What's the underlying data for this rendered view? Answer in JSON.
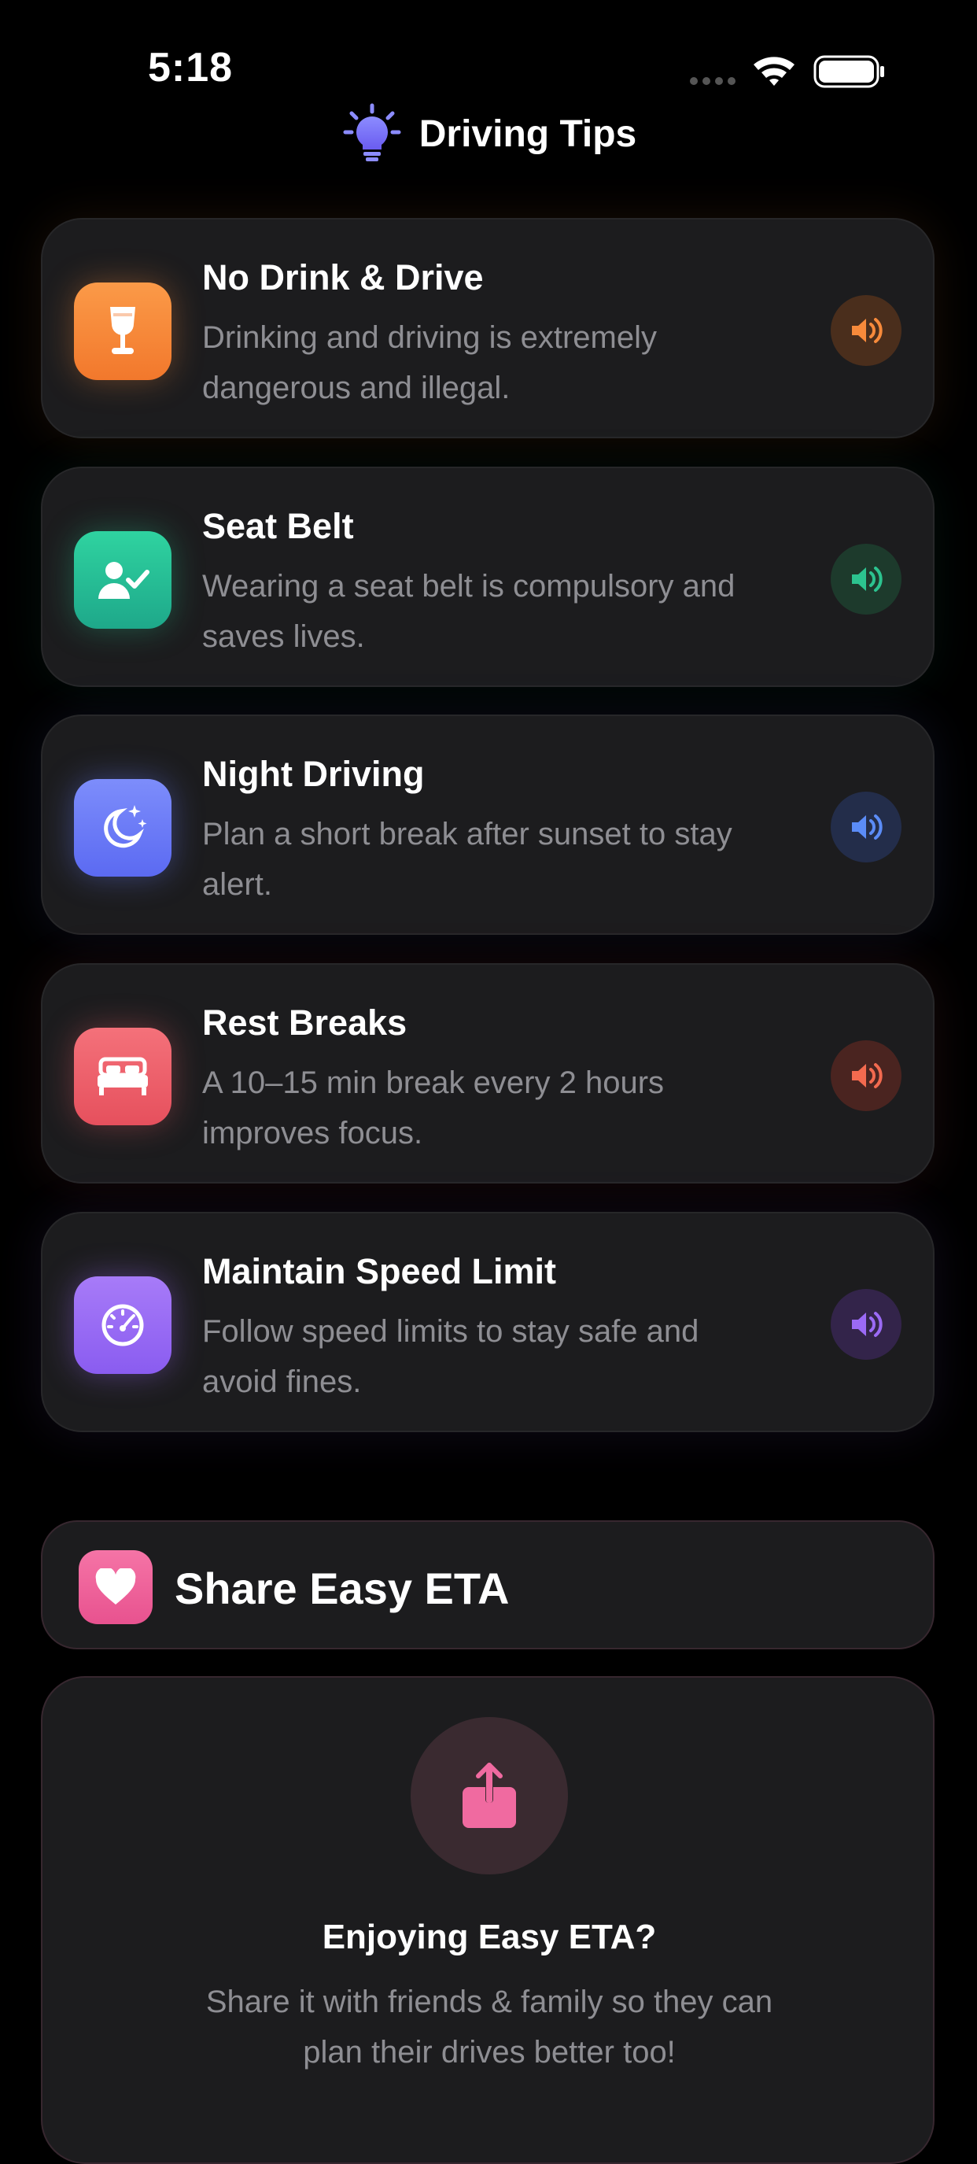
{
  "status_bar": {
    "time": "5:18"
  },
  "header": {
    "title": "Driving Tips"
  },
  "tips": [
    {
      "title": "No Drink & Drive",
      "description": "Drinking and driving is extremely dangerous and illegal.",
      "icon": "wine-glass-icon",
      "color": "#f78a3b"
    },
    {
      "title": "Seat Belt",
      "description": "Wearing a seat belt is compulsory and saves lives.",
      "icon": "person-check-icon",
      "color": "#2cc38f"
    },
    {
      "title": "Night Driving",
      "description": "Plan a short break after sunset to stay alert.",
      "icon": "moon-stars-icon",
      "color": "#6a7cf8"
    },
    {
      "title": "Rest Breaks",
      "description": "A 10–15 min break every 2 hours improves focus.",
      "icon": "bed-icon",
      "color": "#f0616b"
    },
    {
      "title": "Maintain Speed Limit",
      "description": "Follow speed limits to stay safe and avoid fines.",
      "icon": "speedometer-icon",
      "color": "#9b6af5"
    }
  ],
  "share_section": {
    "title": "Share Easy ETA",
    "icon": "heart-icon",
    "color": "#ef5f99"
  },
  "promo": {
    "title": "Enjoying Easy ETA?",
    "description": "Share it with friends & family so they can plan their drives better too!",
    "icon": "share-icon"
  }
}
